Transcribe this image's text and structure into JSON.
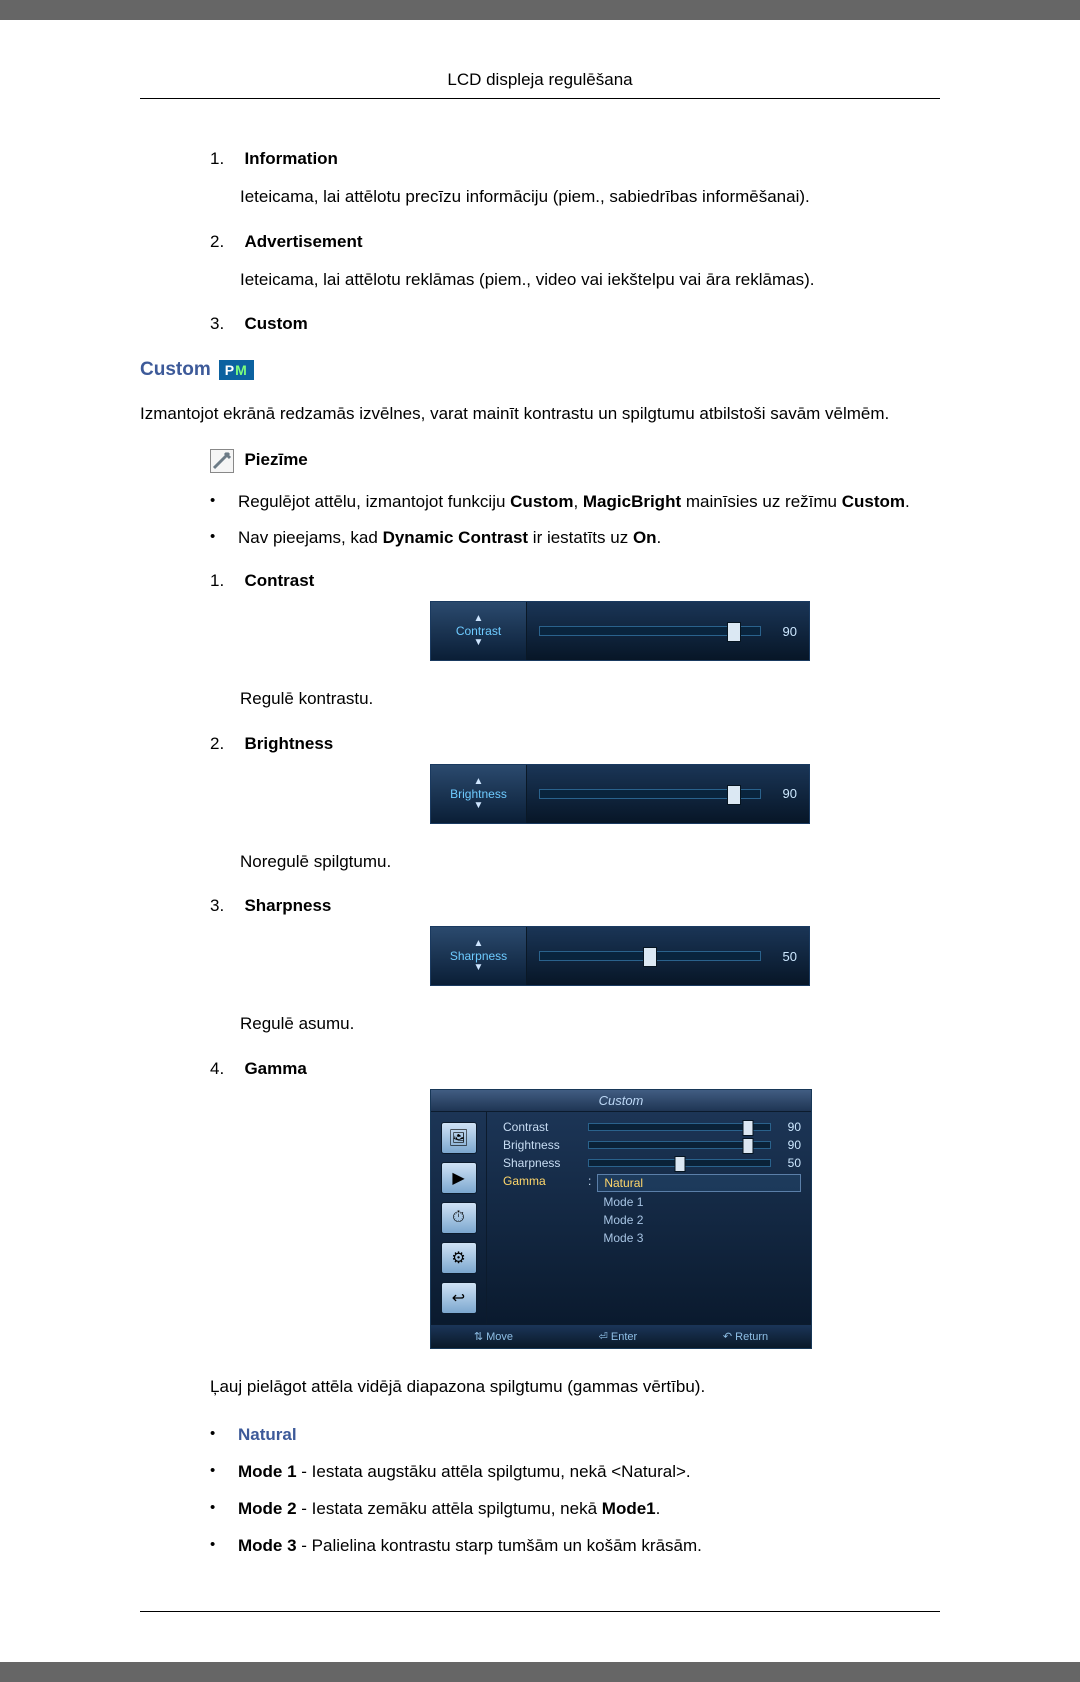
{
  "header": "LCD displeja regulēšana",
  "top_list": [
    {
      "label": "Information",
      "desc": "Ieteicama, lai attēlotu precīzu informāciju (piem., sabiedrības informēšanai)."
    },
    {
      "label": "Advertisement",
      "desc": "Ieteicama, lai attēlotu reklāmas (piem., video vai iekštelpu vai āra reklāmas)."
    },
    {
      "label": "Custom",
      "desc": ""
    }
  ],
  "section_title": "Custom",
  "pm_icon": {
    "p": "P",
    "m": "M"
  },
  "intro": "Izmantojot ekrānā redzamās izvēlnes, varat mainīt kontrastu un spilgtumu atbilstoši savām vēlmēm.",
  "note_label": "Piezīme",
  "notes": [
    {
      "pre": "Regulējot attēlu, izmantojot funkciju ",
      "b1": "Custom",
      "mid1": ", ",
      "b2": "MagicBright",
      "mid2": " mainīsies uz režīmu ",
      "b3": "Custom",
      "end": "."
    },
    {
      "pre": "Nav pieejams, kad ",
      "b1": "Dynamic Contrast",
      "mid1": " ir iestatīts uz ",
      "b2": "On",
      "mid2": "",
      "b3": "",
      "end": "."
    }
  ],
  "controls": [
    {
      "label": "Contrast",
      "osd_label": "Contrast",
      "value": 90,
      "pct": 88,
      "desc": "Regulē kontrastu."
    },
    {
      "label": "Brightness",
      "osd_label": "Brightness",
      "value": 90,
      "pct": 88,
      "desc": "Noregulē spilgtumu."
    },
    {
      "label": "Sharpness",
      "osd_label": "Sharpness",
      "value": 50,
      "pct": 50,
      "desc": "Regulē asumu."
    }
  ],
  "gamma": {
    "label": "Gamma",
    "title": "Custom",
    "rows": [
      {
        "label": "Contrast",
        "value": 90,
        "pct": 88
      },
      {
        "label": "Brightness",
        "value": 90,
        "pct": 88
      },
      {
        "label": "Sharpness",
        "value": 50,
        "pct": 50
      }
    ],
    "sel_label": "Gamma",
    "options": [
      "Natural",
      "Mode 1",
      "Mode 2",
      "Mode 3"
    ],
    "selected": "Natural",
    "footer": {
      "move": "Move",
      "enter": "Enter",
      "return": "Return"
    },
    "desc": "Ļauj pielāgot attēla vidējā diapazona spilgtumu (gammas vērtību)."
  },
  "gamma_modes": [
    {
      "name": "Natural",
      "rest": ""
    },
    {
      "name": "Mode 1",
      "rest": " - Iestata augstāku attēla spilgtumu, nekā <Natural>."
    },
    {
      "name": "Mode 2",
      "rest": " - Iestata zemāku attēla spilgtumu, nekā ",
      "b2": "Mode1",
      "end": "."
    },
    {
      "name": "Mode 3",
      "rest": " - Palielina kontrastu starp tumšām un košām krāsām."
    }
  ],
  "chart_data": [
    {
      "type": "bar",
      "title": "Contrast",
      "categories": [
        "Contrast"
      ],
      "values": [
        90
      ],
      "ylim": [
        0,
        100
      ]
    },
    {
      "type": "bar",
      "title": "Brightness",
      "categories": [
        "Brightness"
      ],
      "values": [
        90
      ],
      "ylim": [
        0,
        100
      ]
    },
    {
      "type": "bar",
      "title": "Sharpness",
      "categories": [
        "Sharpness"
      ],
      "values": [
        50
      ],
      "ylim": [
        0,
        100
      ]
    },
    {
      "type": "table",
      "title": "Custom (Gamma menu)",
      "categories": [
        "Contrast",
        "Brightness",
        "Sharpness",
        "Gamma"
      ],
      "values": [
        "90",
        "90",
        "50",
        "Natural"
      ]
    }
  ]
}
